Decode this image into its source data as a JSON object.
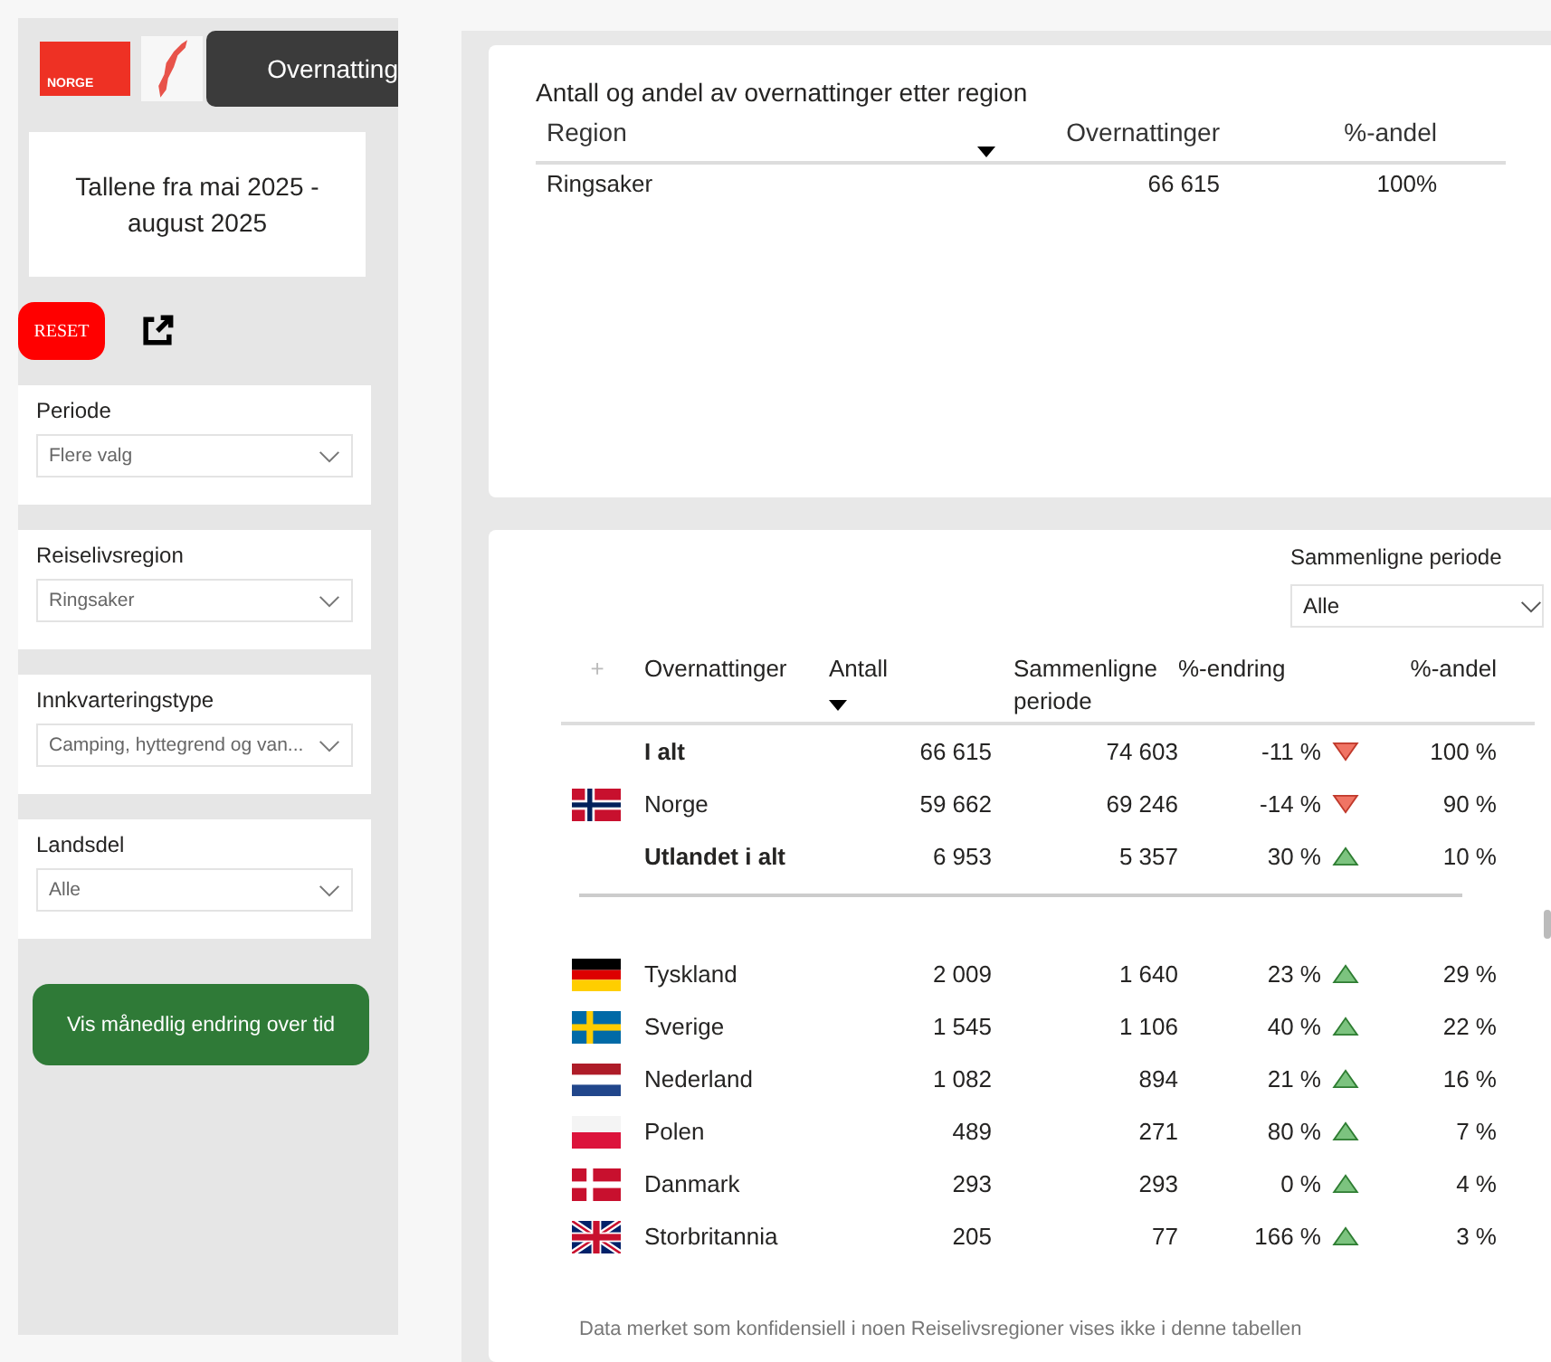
{
  "header": {
    "logo_text": "NORGE",
    "tab": "Overnatting"
  },
  "period_note": "Tallene fra mai 2025 - august 2025",
  "reset_button": "RESET",
  "filters": [
    {
      "label": "Periode",
      "value": "Flere valg"
    },
    {
      "label": "Reiselivsregion",
      "value": "Ringsaker"
    },
    {
      "label": "Innkvarteringstype",
      "value": "Camping, hyttegrend og van..."
    },
    {
      "label": "Landsdel",
      "value": "Alle"
    }
  ],
  "monthly_button": "Vis månedlig endring over tid",
  "region_table": {
    "title": "Antall og andel av overnattinger etter region",
    "columns": [
      "Region",
      "Overnattinger",
      "%-andel"
    ],
    "rows": [
      [
        "Ringsaker",
        "66 615",
        "100%"
      ]
    ]
  },
  "compare": {
    "label": "Sammenligne periode",
    "value": "Alle"
  },
  "country_table": {
    "expand_icon": "+",
    "columns": [
      "Overnattinger",
      "Antall",
      "Sammenligne periode",
      "%-endring",
      "%-andel"
    ],
    "summary_rows": [
      {
        "kind": "total",
        "name": "I alt",
        "antall": "66 615",
        "compare": "74 603",
        "change": "-11 %",
        "increase": false,
        "share": "100 %"
      },
      {
        "kind": "norway",
        "name": "Norge",
        "antall": "59 662",
        "compare": "69 246",
        "change": "-14 %",
        "increase": false,
        "share": "90 %"
      },
      {
        "kind": "total",
        "name": "Utlandet i alt",
        "antall": "6 953",
        "compare": "5 357",
        "change": "30 %",
        "increase": true,
        "share": "10 %"
      }
    ],
    "country_rows": [
      {
        "kind": "germany",
        "name": "Tyskland",
        "antall": "2 009",
        "compare": "1 640",
        "change": "23 %",
        "increase": true,
        "share": "29 %"
      },
      {
        "kind": "sweden",
        "name": "Sverige",
        "antall": "1 545",
        "compare": "1 106",
        "change": "40 %",
        "increase": true,
        "share": "22 %"
      },
      {
        "kind": "netherlands",
        "name": "Nederland",
        "antall": "1 082",
        "compare": "894",
        "change": "21 %",
        "increase": true,
        "share": "16 %"
      },
      {
        "kind": "poland",
        "name": "Polen",
        "antall": "489",
        "compare": "271",
        "change": "80 %",
        "increase": true,
        "share": "7 %"
      },
      {
        "kind": "denmark",
        "name": "Danmark",
        "antall": "293",
        "compare": "293",
        "change": "0 %",
        "increase": true,
        "share": "4 %"
      },
      {
        "kind": "uk",
        "name": "Storbritannia",
        "antall": "205",
        "compare": "77",
        "change": "166 %",
        "increase": true,
        "share": "3 %"
      }
    ],
    "footnote": "Data merket som konfidensiell i noen Reiselivsregioner vises ikke i denne tabellen"
  }
}
